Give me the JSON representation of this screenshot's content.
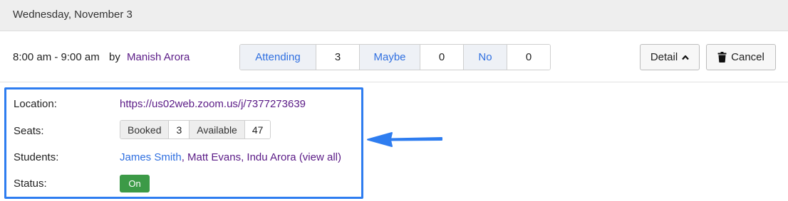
{
  "date_header": "Wednesday, November 3",
  "event": {
    "time": "8:00 am - 9:00 am",
    "by": "by",
    "organizer": "Manish Arora"
  },
  "rsvp": {
    "attending_label": "Attending",
    "attending_count": "3",
    "maybe_label": "Maybe",
    "maybe_count": "0",
    "no_label": "No",
    "no_count": "0"
  },
  "actions": {
    "detail_label": "Detail",
    "cancel_label": "Cancel"
  },
  "details": {
    "location_label": "Location:",
    "location_url": "https://us02web.zoom.us/j/7377273639",
    "seats_label": "Seats:",
    "booked_label": "Booked",
    "booked_count": "3",
    "available_label": "Available",
    "available_count": "47",
    "students_label": "Students:",
    "students": [
      "James Smith",
      "Matt Evans",
      "Indu Arora"
    ],
    "view_all": "(view all)",
    "status_label": "Status:",
    "status_value": "On"
  },
  "colors": {
    "highlight_border": "#2e7df0",
    "status_on": "#3c9a47",
    "link_primary": "#2f6fe0",
    "link_visited": "#5a1a86"
  },
  "icons": {
    "detail_caret": "chevron-up-icon",
    "cancel": "trash-icon",
    "annotation": "arrow-left-icon"
  }
}
